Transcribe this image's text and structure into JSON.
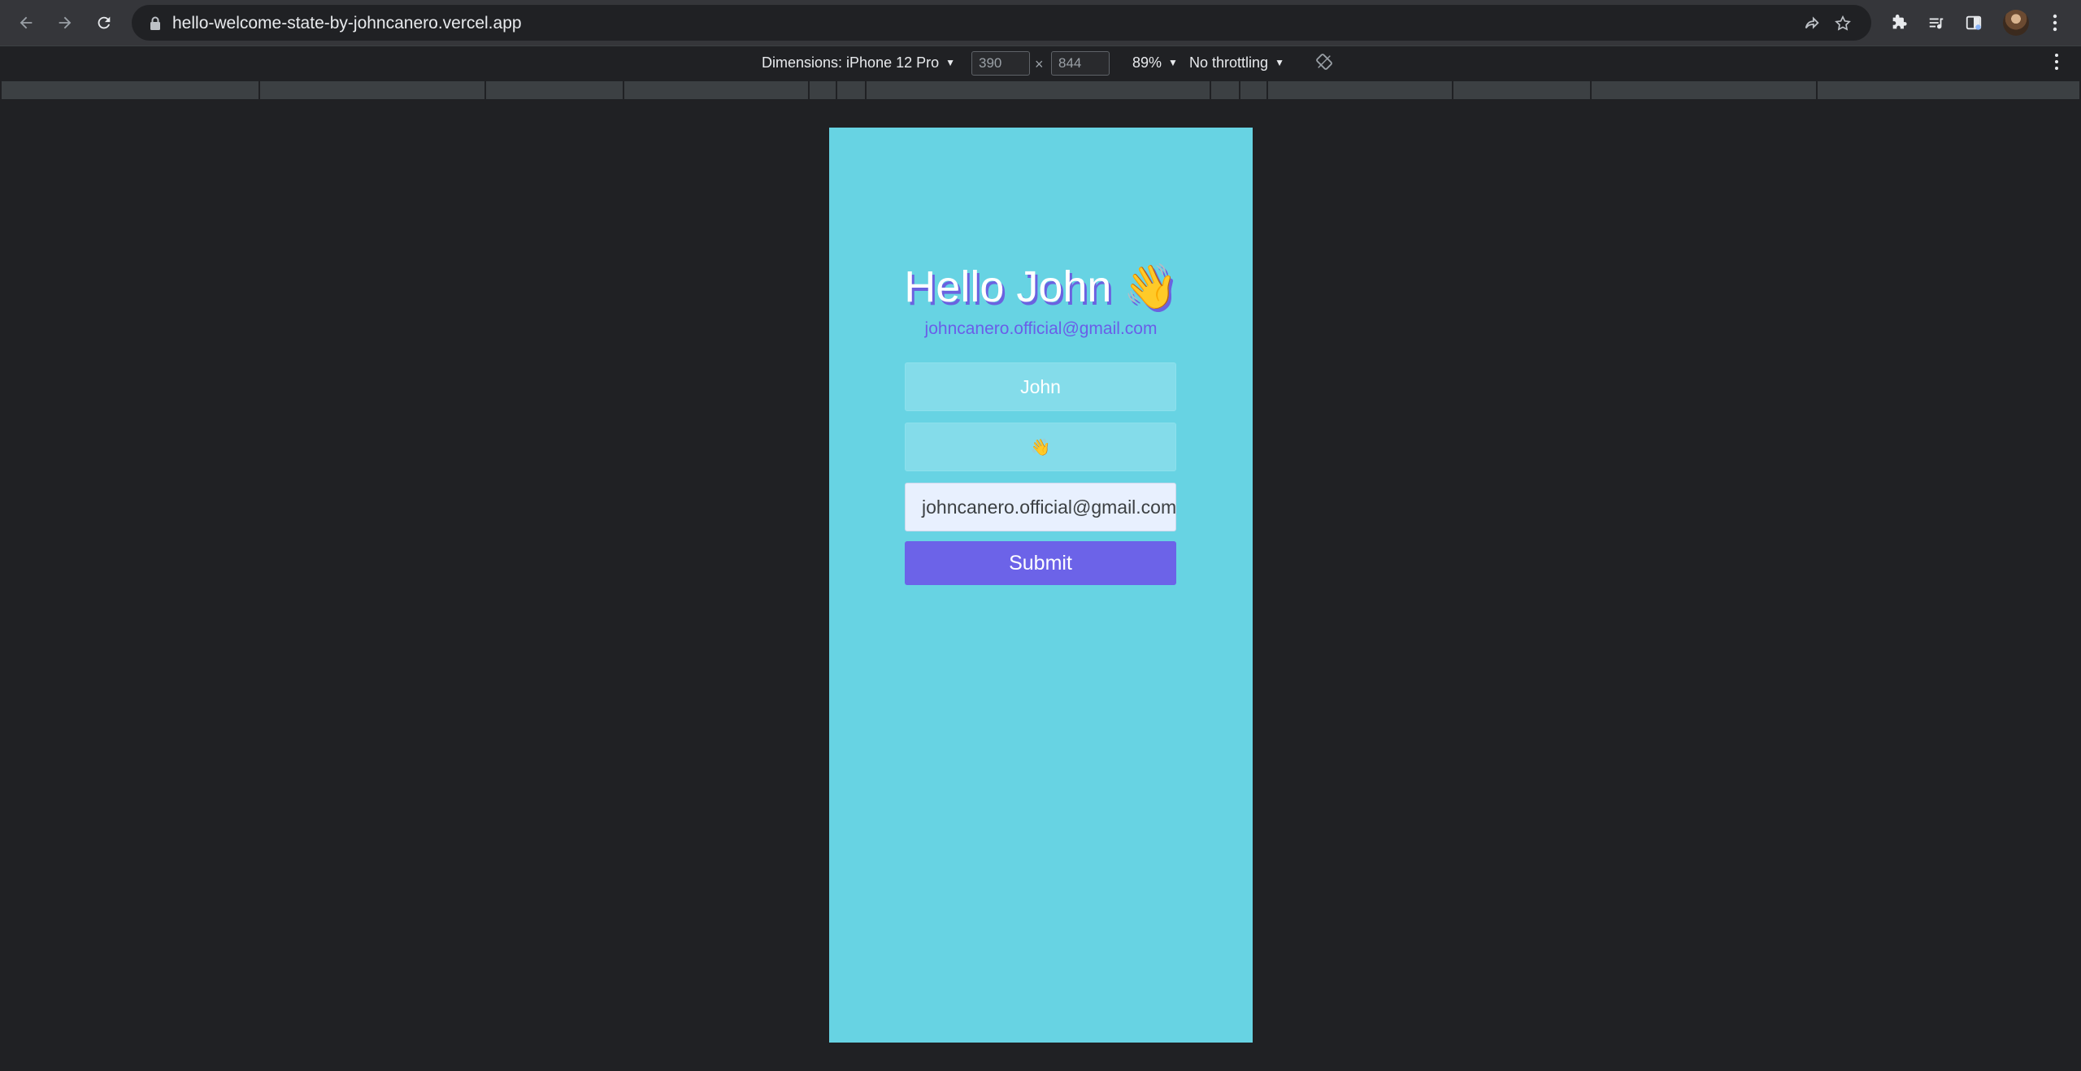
{
  "browser": {
    "url": "hello-welcome-state-by-johncanero.vercel.app"
  },
  "device_toolbar": {
    "dimensions_label": "Dimensions: iPhone 12 Pro",
    "width": "390",
    "height": "844",
    "separator": "×",
    "zoom": "89%",
    "throttling": "No throttling"
  },
  "app": {
    "greeting": "Hello John",
    "greeting_emoji": "👋",
    "email_display": "johncanero.official@gmail.com",
    "name_field": "John",
    "emoji_field": "👋",
    "email_field": "johncanero.official@gmail.com",
    "submit_label": "Submit",
    "colors": {
      "background": "#67d3e3",
      "accent": "#6c63e8",
      "heading_shadow": "#6b62e0"
    }
  }
}
